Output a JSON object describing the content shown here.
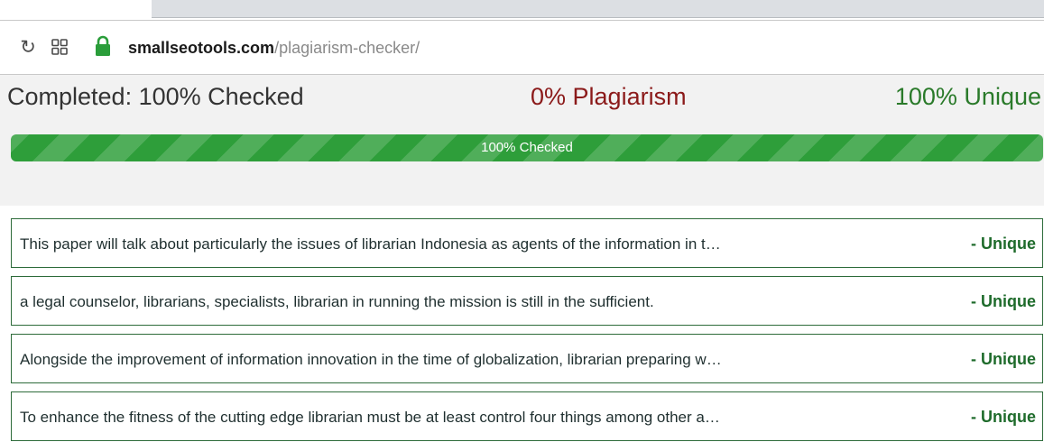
{
  "browser": {
    "url_domain": "smallseotools.com",
    "url_path": "/plagiarism-checker/",
    "icons": [
      "reload-icon",
      "apps-icon",
      "lock-icon"
    ],
    "lock_color": "#2a9d3a"
  },
  "summary": {
    "completed": "Completed: 100% Checked",
    "plagiarism": "0% Plagiarism",
    "unique": "100% Unique"
  },
  "progress": {
    "value_percent": 100,
    "label": "100% Checked",
    "color": "#2e9e3a"
  },
  "results": [
    {
      "text": "This paper will talk about particularly the issues of librarian Indonesia as agents of the information in t…",
      "status": "- Unique"
    },
    {
      "text": "a legal counselor, librarians, specialists, librarian in running the mission is still in the sufficient.",
      "status": "- Unique"
    },
    {
      "text": "Alongside the improvement of information innovation in the time of globalization, librarian preparing w…",
      "status": "- Unique"
    },
    {
      "text": "To enhance the fitness of the cutting edge librarian must be at least control four things among other a…",
      "status": "- Unique"
    }
  ]
}
